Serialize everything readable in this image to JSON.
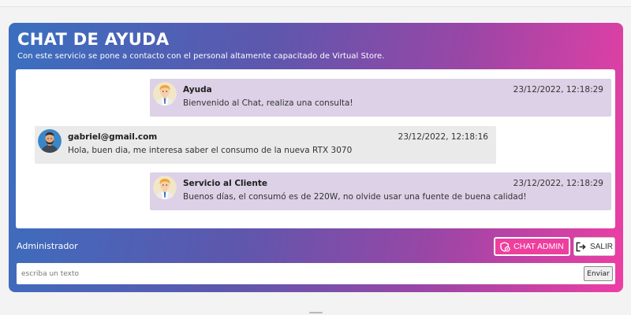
{
  "header": {
    "title": "CHAT DE AYUDA",
    "subtitle": "Con este servicio se pone a contacto con el personal altamente capacitado de Virtual Store."
  },
  "messages": [
    {
      "sender": "Ayuda",
      "time": "23/12/2022, 12:18:29",
      "text": "Bienvenido al Chat, realiza una consulta!",
      "avatar_icon": "support-agent-avatar-icon",
      "side": "right"
    },
    {
      "sender": "gabriel@gmail.com",
      "time": "23/12/2022, 12:18:16",
      "text": "Hola, buen dia, me interesa saber el consumo de la nueva RTX 3070",
      "avatar_icon": "user-avatar-icon",
      "side": "left"
    },
    {
      "sender": "Servicio al Cliente",
      "time": "23/12/2022, 12:18:29",
      "text": "Buenos días, el consumó es de 220W, no olvide usar una fuente de buena calidad!",
      "avatar_icon": "support-agent-avatar-icon",
      "side": "right"
    }
  ],
  "footer": {
    "role_label": "Administrador",
    "chat_admin_label": "CHAT ADMIN",
    "chat_admin_icon": "shield-chat-icon",
    "logout_label": "SALIR",
    "logout_icon": "logout-icon"
  },
  "composer": {
    "placeholder": "escriba un texto",
    "value": "",
    "send_label": "Enviar"
  },
  "colors": {
    "gradient_start": "#3a6fc0",
    "gradient_end": "#ee3ea4",
    "bot_bubble": "#dcd1e6",
    "user_bubble": "#eaeaea",
    "accent_button": "#ee3f9e"
  }
}
